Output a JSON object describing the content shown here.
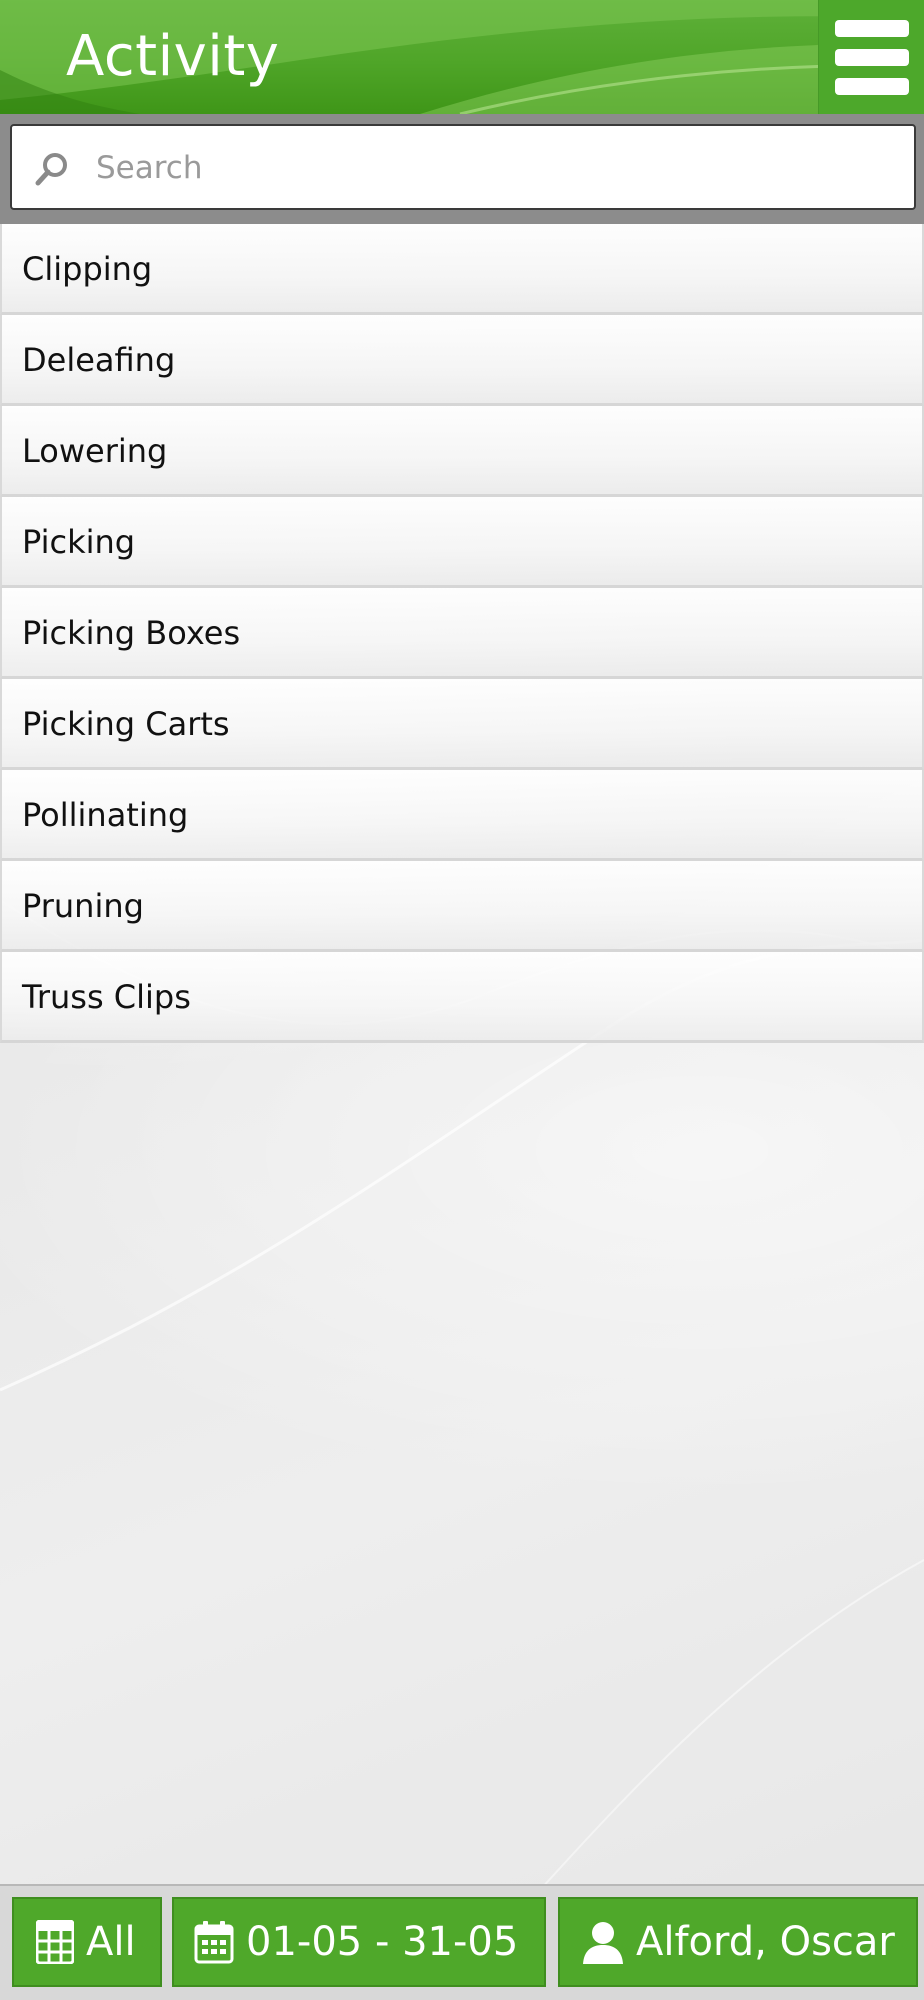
{
  "header": {
    "title": "Activity",
    "menu_icon": "hamburger-menu-icon",
    "accent_color": "#4fa528"
  },
  "search": {
    "placeholder": "Search",
    "value": "",
    "icon": "search-icon"
  },
  "activities": [
    {
      "label": "Clipping"
    },
    {
      "label": "Deleafing"
    },
    {
      "label": "Lowering"
    },
    {
      "label": "Picking"
    },
    {
      "label": "Picking Boxes"
    },
    {
      "label": "Picking Carts"
    },
    {
      "label": "Pollinating"
    },
    {
      "label": "Pruning"
    },
    {
      "label": "Truss Clips"
    }
  ],
  "footer": {
    "filter": {
      "label": "All",
      "icon": "grid-icon"
    },
    "date_range": {
      "label": "01-05 - 31-05",
      "icon": "calendar-icon"
    },
    "user": {
      "label": "Alford, Oscar",
      "icon": "user-icon"
    }
  }
}
